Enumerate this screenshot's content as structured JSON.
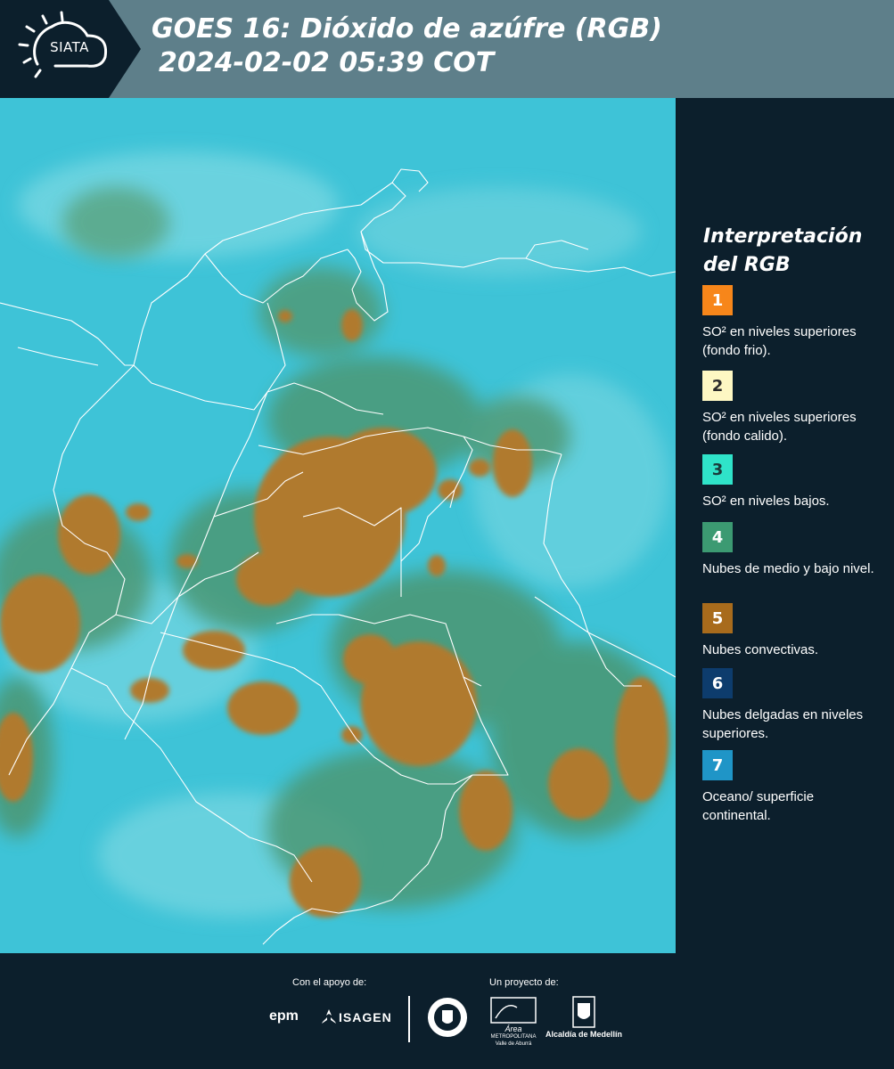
{
  "header": {
    "logo_text": "SIATA",
    "title_line1": "GOES 16: Dióxido de azúfre (RGB)",
    "title_line2": "2024-02-02 05:39 COT",
    "background_color": "#5e7f8a",
    "logo_color": "#0c1f2c"
  },
  "legend": {
    "title": "Interpretación del RGB",
    "items": [
      {
        "number": "1",
        "description": "SO² en niveles superiores (fondo frio).",
        "color": "#f7861a",
        "text_color": "#ffffff"
      },
      {
        "number": "2",
        "description": "SO² en niveles superiores (fondo calido).",
        "color": "#fdf7c3",
        "text_color": "#2b2b2b"
      },
      {
        "number": "3",
        "description": "SO² en niveles bajos.",
        "color": "#2fe3c9",
        "text_color": "#1a3a3a"
      },
      {
        "number": "4",
        "description": "Nubes de medio y bajo nivel.",
        "color": "#3c9a72",
        "text_color": "#ffffff"
      },
      {
        "number": "5",
        "description": "Nubes convectivas.",
        "color": "#a86b1c",
        "text_color": "#ffffff"
      },
      {
        "number": "6",
        "description": "Nubes delgadas en niveles superiores.",
        "color": "#0d3c6d",
        "text_color": "#ffffff"
      },
      {
        "number": "7",
        "description": "Oceano/ superficie continental.",
        "color": "#1f95c7",
        "text_color": "#ffffff"
      }
    ]
  },
  "map": {
    "background_color": "#3cc2d6",
    "convective_color": "#b07a2e",
    "low_cloud_color": "#4a9a72",
    "border_color": "#ffffff"
  },
  "footer": {
    "support_label": "Con el apoyo de:",
    "project_label": "Un proyecto de:",
    "brand_epm": "epm",
    "brand_isagen": "ISAGEN",
    "brand_area": "Área",
    "brand_area_sub1": "METROPOLITANA",
    "brand_area_sub2": "Valle de Aburrá",
    "brand_alcaldia": "Alcaldía de Medellín"
  }
}
